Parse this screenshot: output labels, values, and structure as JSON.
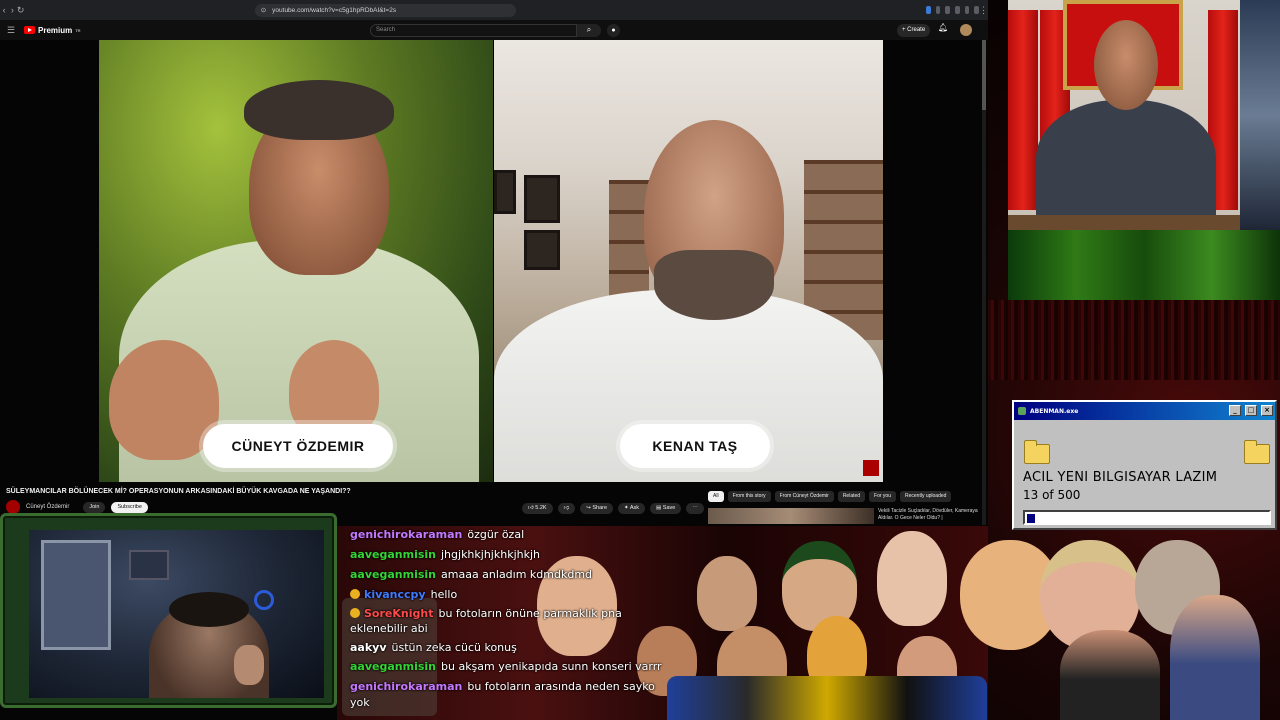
{
  "browser": {
    "url": "youtube.com/watch?v=c5g1hpRDbAI&t=2s"
  },
  "youtube": {
    "logo_text": "Premium",
    "logo_sup": "TR",
    "search_placeholder": "Search",
    "create_label": "Create"
  },
  "video": {
    "left_name": "CÜNEYT ÖZDEMIR",
    "right_name": "KENAN TAŞ",
    "title": "SÜLEYMANCILAR BÖLÜNECEK Mİ? OPERASYONUN ARKASINDAKİ BÜYÜK KAVGADA NE YAŞANDI??",
    "channel": "Cüneyt Özdemir",
    "join_label": "Join",
    "subscribe_label": "Subscribe",
    "likes": "5.2K",
    "share_label": "Share",
    "ask_label": "Ask",
    "save_label": "Save"
  },
  "related": {
    "chips": [
      "All",
      "From this story",
      "From Cüneyt Özdemir",
      "Related",
      "For you",
      "Recently uploaded"
    ],
    "selected_chip": "All",
    "first_title": "Vekili Tacizle Suçladılar, Dövdüler, Kameraya Aldılar. O Gece Neler Oldu? |"
  },
  "popup": {
    "title": "ABENMAN.exe",
    "message": "ACIL YENI BILGISAYAR LAZIM",
    "count": "13 of 500",
    "progress": 0.026
  },
  "chat": [
    {
      "user": "genichirokaraman",
      "text": "özgür özal",
      "color": "#c678ff",
      "coin": false
    },
    {
      "user": "aaveganmisin",
      "text": "jhgjkhkjhjkhkjhkjh",
      "color": "#35d435",
      "coin": false
    },
    {
      "user": "aaveganmisin",
      "text": "amaaa anladım kdmdkdmd",
      "color": "#35d435",
      "coin": false
    },
    {
      "user": "kivanccpy",
      "text": "hello",
      "color": "#3f7bff",
      "coin": true
    },
    {
      "user": "SoreKnight",
      "text": "bu fotoların önüne parmaklık pna",
      "color": "#ff4a4a",
      "coin": true
    },
    {
      "user": "",
      "text": "eklenebilir abi",
      "color": "#ffffff",
      "coin": false
    },
    {
      "user": "aakyv",
      "text": "üstün zeka cücü konuş",
      "color": "#ffffff",
      "coin": false
    },
    {
      "user": "aaveganmisin",
      "text": "bu akşam yenikapıda sunn konseri varrr",
      "color": "#35d435",
      "coin": false
    },
    {
      "user": "genichirokaraman",
      "text": "bu fotoların arasında neden sayko",
      "color": "#c678ff",
      "coin": false
    },
    {
      "user": "",
      "text": "yok",
      "color": "#ffffff",
      "coin": false
    }
  ],
  "icons": [
    "hamburger-icon",
    "youtube-logo-icon",
    "search-icon",
    "mic-icon",
    "plus-icon",
    "bell-icon",
    "like-icon",
    "dislike-icon",
    "share-icon",
    "ask-icon",
    "save-icon",
    "more-icon",
    "folder-icon"
  ]
}
